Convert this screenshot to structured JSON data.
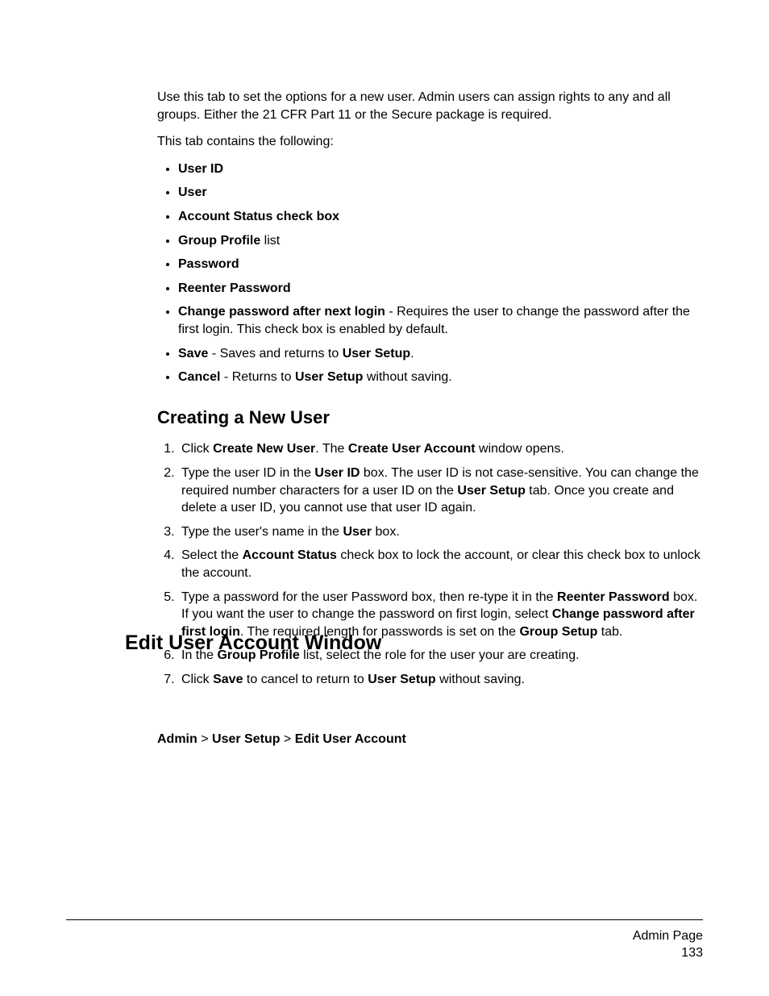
{
  "intro": {
    "p1": "Use this tab to set the options for a new user. Admin users can assign rights to any and all groups. Either the 21 CFR Part 11 or the Secure package is required.",
    "p2": "This tab contains the following:"
  },
  "bullets": {
    "b1": "User ID",
    "b2": "User",
    "b3": "Account Status check box",
    "b4_bold": "Group Profile",
    "b4_rest": " list",
    "b5": "Password",
    "b6": "Reenter Password",
    "b7_bold": "Change password after next login",
    "b7_rest": " - Requires the user to change the password after the first login. This check box is enabled by default.",
    "b8_bold": "Save",
    "b8_mid": " - Saves and returns to ",
    "b8_bold2": "User Setup",
    "b8_end": ".",
    "b9_bold": "Cancel",
    "b9_mid": " - Returns to ",
    "b9_bold2": "User Setup",
    "b9_end": " without saving."
  },
  "sub1_title": "Creating a New User",
  "steps": {
    "s1_a": "Click ",
    "s1_b": "Create New User",
    "s1_c": ". The ",
    "s1_d": "Create User Account",
    "s1_e": " window opens.",
    "s2_a": "Type the user ID in the ",
    "s2_b": "User ID",
    "s2_c": " box. The user ID is not case-sensitive. You can change the required number characters for a user ID on the ",
    "s2_d": "User Setup",
    "s2_e": " tab. Once you create and delete a user ID, you cannot use that user ID again.",
    "s3_a": "Type the user's name in the ",
    "s3_b": "User",
    "s3_c": " box.",
    "s4_a": "Select the ",
    "s4_b": "Account Status",
    "s4_c": " check box to lock the account, or clear this check box to unlock the account.",
    "s5_a": "Type a password for the user Password box, then re-type it in the ",
    "s5_b": "Reenter Password",
    "s5_c": " box. If you want the user to change the password on first login, select ",
    "s5_d": "Change password after first login",
    "s5_e": ". The required length for passwords is set on the ",
    "s5_f": "Group Setup",
    "s5_g": " tab.",
    "s6_a": "In the ",
    "s6_b": "Group Profile",
    "s6_c": " list, select the role for the user your are creating.",
    "s7_a": "Click ",
    "s7_b": "Save",
    "s7_c": " to cancel to return to ",
    "s7_d": "User Setup",
    "s7_e": " without saving."
  },
  "h1_title": "Edit User Account Window",
  "breadcrumb": {
    "a": "Admin",
    "sep": " > ",
    "b": "User Setup",
    "c": "Edit User Account"
  },
  "footer": {
    "label": "Admin Page",
    "page": "133"
  }
}
